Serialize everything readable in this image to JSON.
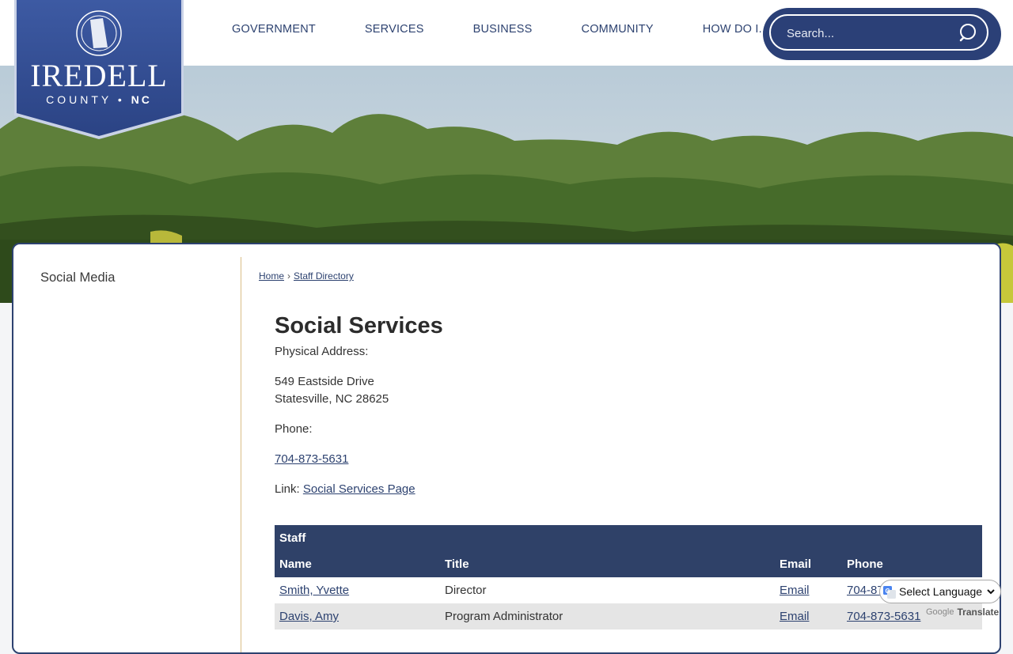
{
  "logo": {
    "name": "IREDELL",
    "sub_county": "COUNTY",
    "sub_state": "NC"
  },
  "nav": {
    "items": [
      {
        "label": "GOVERNMENT"
      },
      {
        "label": "SERVICES"
      },
      {
        "label": "BUSINESS"
      },
      {
        "label": "COMMUNITY"
      },
      {
        "label": "HOW DO I..."
      }
    ]
  },
  "search": {
    "placeholder": "Search...",
    "icon": "search-icon"
  },
  "sidebar": {
    "items": [
      {
        "label": "Social Media"
      }
    ]
  },
  "breadcrumb": {
    "home": "Home",
    "separator": "›",
    "current": "Staff Directory"
  },
  "department": {
    "title": "Social Services",
    "address_label": "Physical Address:",
    "address_line1": "549 Eastside Drive",
    "address_line2": "Statesville, NC 28625",
    "phone_label": "Phone:",
    "phone": "704-873-5631",
    "link_label": "Link:",
    "link_text": "Social Services Page"
  },
  "staff_table": {
    "caption": "Staff",
    "headers": {
      "name": "Name",
      "title": "Title",
      "email": "Email",
      "phone": "Phone"
    },
    "rows": [
      {
        "name": "Smith, Yvette",
        "title": "Director",
        "email": "Email",
        "phone": "704-873-5631"
      },
      {
        "name": "Davis, Amy",
        "title": "Program Administrator",
        "email": "Email",
        "phone": "704-873-5631"
      }
    ]
  },
  "translate": {
    "select_label": "Select Language",
    "powered_by": "Google",
    "translate_label": "Translate"
  },
  "colors": {
    "brand_navy": "#2d4270",
    "table_header": "#2f4168",
    "accent_gold": "#d9bd86"
  }
}
